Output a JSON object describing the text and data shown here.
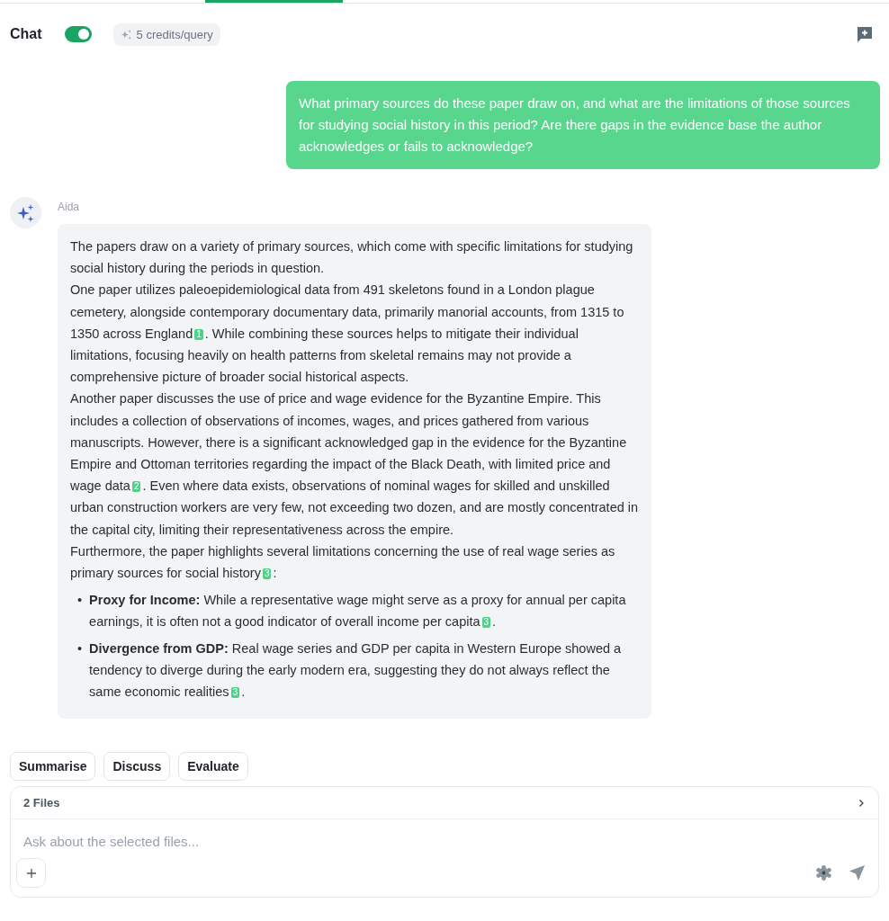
{
  "header": {
    "title": "Chat",
    "toggle_on": true,
    "credits": "5 credits/query"
  },
  "user_message": "What primary sources do these paper draw on, and what are the limitations of those sources for studying social history in this period? Are there gaps in the evidence base the author acknowledges or fails to acknowledge?",
  "assistant": {
    "name": "Aida",
    "paragraphs": [
      [
        {
          "text": "The papers draw on a variety of primary sources, which come with specific limitations for studying social history during the periods in question."
        }
      ],
      [
        {
          "text": "One paper utilizes paleoepidemiological data from 491 skeletons found in a London plague cemetery, alongside contemporary documentary data, primarily manorial accounts, from 1315 to 1350 across England",
          "cite": "1"
        },
        {
          "text": ". While combining these sources helps to mitigate their individual limitations, focusing heavily on health patterns from skeletal remains may not provide a comprehensive picture of broader social historical aspects."
        }
      ],
      [
        {
          "text": "Another paper discusses the use of price and wage evidence for the Byzantine Empire. This includes a collection of observations of incomes, wages, and prices gathered from various manuscripts. However, there is a significant acknowledged gap in the evidence for the Byzantine Empire and Ottoman territories regarding the impact of the Black Death, with limited price and wage data",
          "cite": "2"
        },
        {
          "text": ". Even where data exists, observations of nominal wages for skilled and unskilled urban construction workers are very few, not exceeding two dozen, and are mostly concentrated in the capital city, limiting their representativeness across the empire."
        }
      ],
      [
        {
          "text": "Furthermore, the paper highlights several limitations concerning the use of real wage series as primary sources for social history",
          "cite": "3"
        },
        {
          "text": ":"
        }
      ]
    ],
    "bullets": [
      {
        "marker": "•",
        "label": "Proxy for Income:",
        "parts": [
          {
            "text": " While a representative wage might serve as a proxy for annual per capita earnings, it is often not a good indicator of overall income per capita",
            "cite": "3"
          },
          {
            "text": "."
          }
        ]
      },
      {
        "marker": "•",
        "label": "Divergence from GDP:",
        "parts": [
          {
            "text": " Real wage series and GDP per capita in Western Europe showed a tendency to diverge during the early modern era, suggesting they do not always reflect the same economic realities",
            "cite": "3"
          },
          {
            "text": "."
          }
        ]
      }
    ]
  },
  "actions": [
    "Summarise",
    "Discuss",
    "Evaluate"
  ],
  "composer": {
    "files": "2 Files",
    "placeholder": "Ask about the selected files..."
  }
}
